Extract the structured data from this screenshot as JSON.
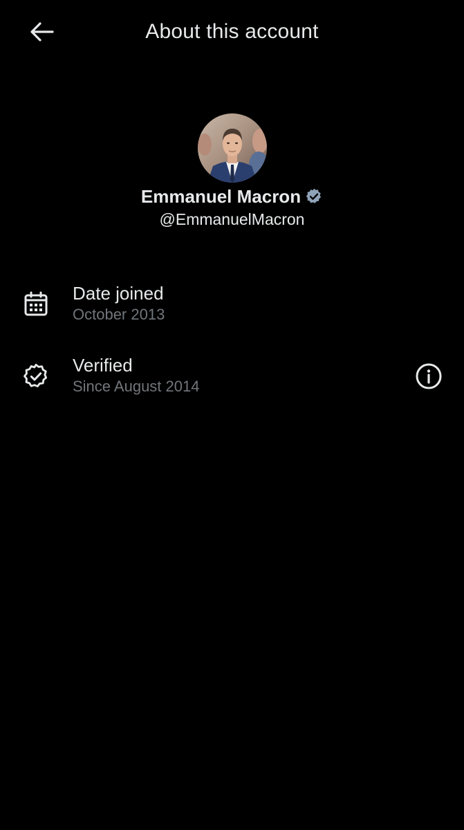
{
  "header": {
    "title": "About this account",
    "back_icon": "arrow-left-icon"
  },
  "profile": {
    "display_name": "Emmanuel Macron",
    "handle": "@EmmanuelMacron",
    "verified_badge_color": "#8fa3b8"
  },
  "details": [
    {
      "icon": "calendar-icon",
      "label": "Date joined",
      "value": "October 2013"
    },
    {
      "icon": "verified-check-icon",
      "label": "Verified",
      "value": "Since August 2014",
      "action_icon": "info-icon"
    }
  ],
  "colors": {
    "background": "#000000",
    "primary_text": "#e7e9ea",
    "secondary_text": "#71767b"
  }
}
